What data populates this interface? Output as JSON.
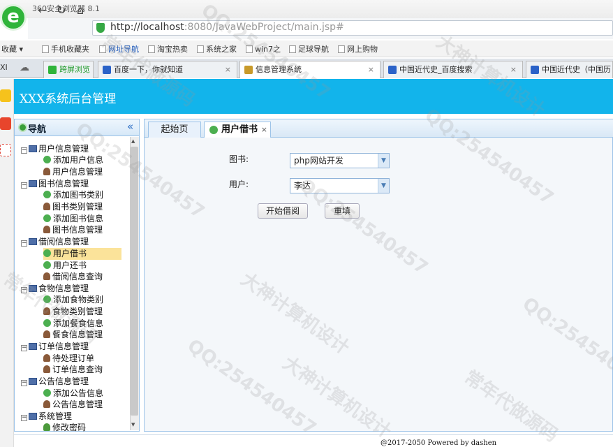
{
  "browser": {
    "app_title": "360安全浏览器 8.1",
    "logo_glyph": "e",
    "url_host": "http://localhost",
    "url_rest": ":8080/JavaWebProject/main.jsp#",
    "bookmarks": [
      "收藏",
      "手机收藏夹",
      "网址导航",
      "淘宝热卖",
      "系统之家",
      "win7之",
      "足球导航",
      "网上购物"
    ],
    "tabs_prefix": "XI",
    "tabs": [
      {
        "label": "跨屏浏览"
      },
      {
        "label": "百度一下，你就知道"
      },
      {
        "label": "信息管理系统"
      },
      {
        "label": "中国近代史_百度搜索"
      },
      {
        "label": "中国近代史（中国历"
      }
    ]
  },
  "header": {
    "title": "XXX系统后台管理"
  },
  "nav": {
    "title": "导航",
    "collapse_glyph": "«",
    "groups": [
      {
        "label": "用户信息管理",
        "items": [
          "添加用户信息",
          "用户信息管理"
        ]
      },
      {
        "label": "图书信息管理",
        "items": [
          "添加图书类别",
          "图书类别管理",
          "添加图书信息",
          "图书信息管理"
        ]
      },
      {
        "label": "借阅信息管理",
        "items": [
          "用户借书",
          "用户还书",
          "借阅信息查询"
        ]
      },
      {
        "label": "食物信息管理",
        "items": [
          "添加食物类别",
          "食物类别管理",
          "添加餐食信息",
          "餐食信息管理"
        ]
      },
      {
        "label": "订单信息管理",
        "items": [
          "待处理订单",
          "订单信息查询"
        ]
      },
      {
        "label": "公告信息管理",
        "items": [
          "添加公告信息",
          "公告信息管理"
        ]
      },
      {
        "label": "系统管理",
        "items": [
          "修改密码"
        ]
      }
    ]
  },
  "content": {
    "tabs": [
      {
        "label": "起始页"
      },
      {
        "label": "用户借书"
      }
    ],
    "form": {
      "book_label": "图书:",
      "book_value": "php网站开发",
      "user_label": "用户:",
      "user_value": "李达",
      "submit_label": "开始借阅",
      "reset_label": "重填"
    }
  },
  "footer": {
    "copyright": "@2017-2050  Powered by dashen"
  },
  "watermarks": [
    "QQ:254540457",
    "大神计算机设计",
    "常年代做源码",
    "QQ:254540457",
    "大神计算机设计",
    "QQ:254540457",
    "QQ:254540457",
    "大神计算机设计",
    "常年代做源码"
  ],
  "colors": {
    "header_bg": "#12b4eb",
    "selected_item": "#fbe39a",
    "panel_border": "#9cc3e8"
  }
}
